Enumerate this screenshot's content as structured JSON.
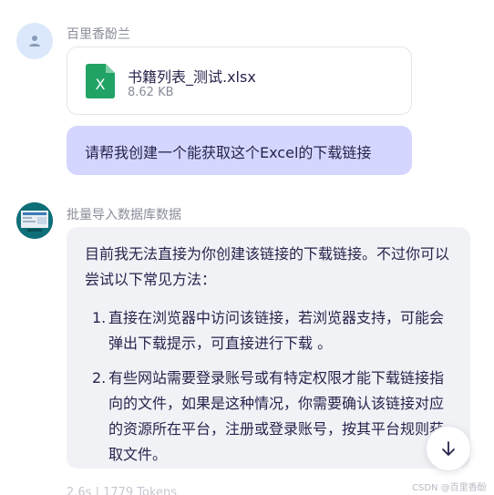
{
  "user": {
    "name": "百里香酚兰",
    "file": {
      "name": "书籍列表_测试.xlsx",
      "size": "8.62 KB",
      "icon": "excel-file-icon"
    },
    "message": "请帮我创建一个能获取这个Excel的下载链接"
  },
  "bot": {
    "name": "批量导入数据库数据",
    "intro": "目前我无法直接为你创建该链接的下载链接。不过你可以尝试以下常见方法：",
    "items": [
      {
        "num": "1.",
        "text": "直接在浏览器中访问该链接，若浏览器支持，可能会弹出下载提示，可直接进行下载 。"
      },
      {
        "num": "2.",
        "text": "有些网站需要登录账号或有特定权限才能下载链接指向的文件，如果是这种情况，你需要确认该链接对应的资源所在平台，注册或登录账号，按其平台规则获取文件。"
      }
    ]
  },
  "footer": {
    "tokens": "2.6s | 1779 Tokens",
    "watermark": "CSDN @百里香酚兰"
  },
  "colors": {
    "user_bubble": "#d5d6ff",
    "bot_bubble": "#f1f2f6",
    "excel_green": "#21a366"
  }
}
